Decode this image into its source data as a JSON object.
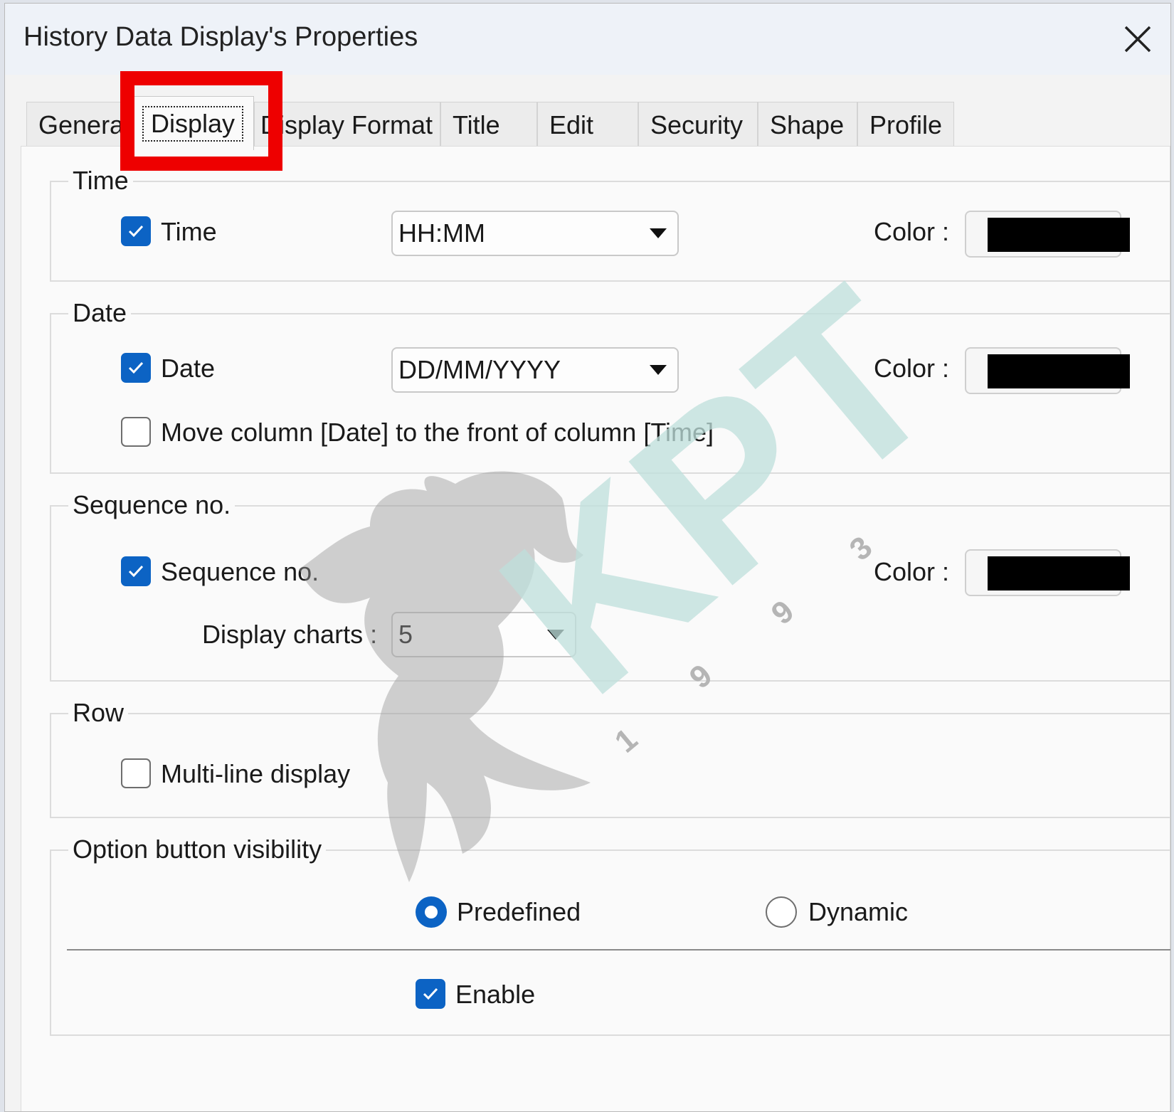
{
  "window": {
    "title": "History Data Display's Properties"
  },
  "tabs": [
    {
      "label": "General"
    },
    {
      "label": "Display"
    },
    {
      "label": "Display Format"
    },
    {
      "label": "Title"
    },
    {
      "label": "Edit"
    },
    {
      "label": "Security"
    },
    {
      "label": "Shape"
    },
    {
      "label": "Profile"
    }
  ],
  "groups": {
    "time": {
      "legend": "Time",
      "checkbox_label": "Time",
      "checked": true,
      "format": "HH:MM",
      "color_label": "Color :",
      "color": "#000000"
    },
    "date": {
      "legend": "Date",
      "checkbox_label": "Date",
      "checked": true,
      "format": "DD/MM/YYYY",
      "color_label": "Color :",
      "color": "#000000",
      "move_label": "Move column [Date] to the front of column [Time]",
      "move_checked": false
    },
    "sequence": {
      "legend": "Sequence no.",
      "checkbox_label": "Sequence no.",
      "checked": true,
      "color_label": "Color :",
      "color": "#000000",
      "charts_label": "Display charts :",
      "charts_value": "5"
    },
    "row": {
      "legend": "Row",
      "multiline_label": "Multi-line display",
      "multiline_checked": false
    },
    "option": {
      "legend": "Option button visibility",
      "predefined_label": "Predefined",
      "dynamic_label": "Dynamic",
      "selected": "Predefined",
      "enable_label": "Enable",
      "enable_checked": true
    }
  },
  "watermark": {
    "text": "KPT",
    "digits": [
      "1",
      "9",
      "9",
      "3"
    ],
    "icon": "rearing-horse-icon"
  },
  "colors": {
    "accent": "#0c63c4",
    "highlight": "#ee0000",
    "watermark": "#bfe0dc"
  }
}
